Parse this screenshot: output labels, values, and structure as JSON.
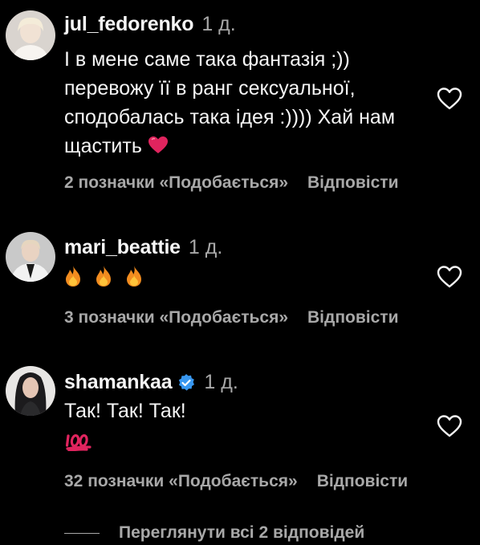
{
  "comments": [
    {
      "username": "jul_fedorenko",
      "time": "1 д.",
      "text_lines": [
        "І в мене саме така фантазія ;))",
        "перевожу її в ранг сексуальної,",
        "сподобалась така ідея :)))) Хай нам",
        "щастить"
      ],
      "emoji": "red-heart-icon",
      "likes": "2 позначки «Подобається»",
      "reply": "Відповісти"
    },
    {
      "username": "mari_beattie",
      "time": "1 д.",
      "emoji": "fire-icon x3",
      "likes": "3 позначки «Подобається»",
      "reply": "Відповісти"
    },
    {
      "username": "shamankaa",
      "verified": true,
      "time": "1 д.",
      "text": "Так! Так! Так!",
      "emoji": "hundred-points-icon",
      "likes": "32 позначки «Подобається»",
      "reply": "Відповісти"
    }
  ],
  "view_replies": "Переглянути всі 2 відповідей",
  "colors": {
    "background": "#000000",
    "text_primary": "#f5f5f5",
    "text_secondary": "#a8a8a8",
    "verified_blue": "#3897f0",
    "heart_red": "#e0245e",
    "fire_orange": "#f28c1f"
  }
}
